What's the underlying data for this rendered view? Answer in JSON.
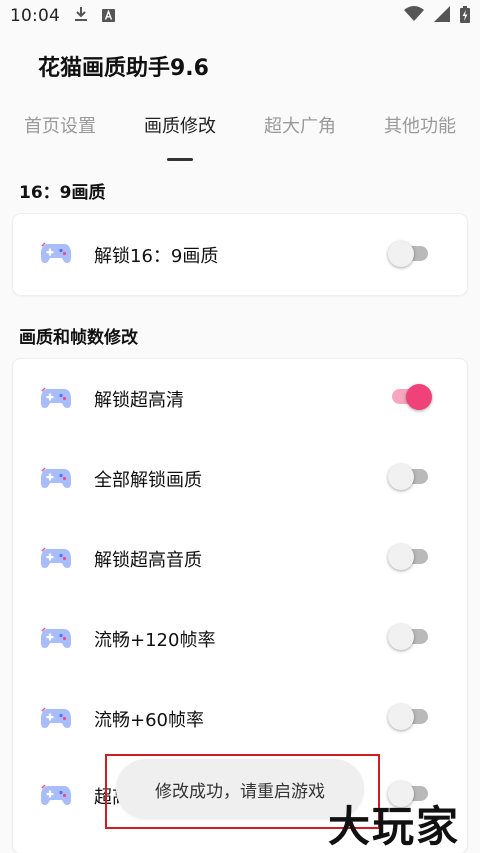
{
  "status_bar": {
    "time": "10:04",
    "left_icons": [
      "download-icon",
      "a-box-icon"
    ],
    "right_icons": [
      "wifi-icon",
      "signal-icon",
      "battery-charging-icon"
    ]
  },
  "app": {
    "title": "花猫画质助手9.6"
  },
  "tabs": [
    {
      "label": "首页设置",
      "active": false
    },
    {
      "label": "画质修改",
      "active": true
    },
    {
      "label": "超大广角",
      "active": false
    },
    {
      "label": "其他功能",
      "active": false
    }
  ],
  "sections": [
    {
      "header": "16：9画质",
      "items": [
        {
          "label": "解锁16：9画质",
          "icon": "gamepad-icon",
          "enabled": false
        }
      ]
    },
    {
      "header": "画质和帧数修改",
      "items": [
        {
          "label": "解锁超高清",
          "icon": "gamepad-icon",
          "enabled": true
        },
        {
          "label": "全部解锁画质",
          "icon": "gamepad-icon",
          "enabled": false
        },
        {
          "label": "解锁超高音质",
          "icon": "gamepad-icon",
          "enabled": false
        },
        {
          "label": "流畅+120帧率",
          "icon": "gamepad-icon",
          "enabled": false
        },
        {
          "label": "流畅+60帧率",
          "icon": "gamepad-icon",
          "enabled": false
        },
        {
          "label": "超高清+60帧率",
          "icon": "gamepad-icon",
          "enabled": false
        }
      ]
    }
  ],
  "toast": {
    "message": "修改成功，请重启游戏"
  },
  "watermark": {
    "text": "大玩家"
  },
  "colors": {
    "accent": "#f0417a",
    "accent_track": "#f7a6c0",
    "switch_off_track": "#b9b9b9",
    "highlight_border": "#d21c24"
  }
}
